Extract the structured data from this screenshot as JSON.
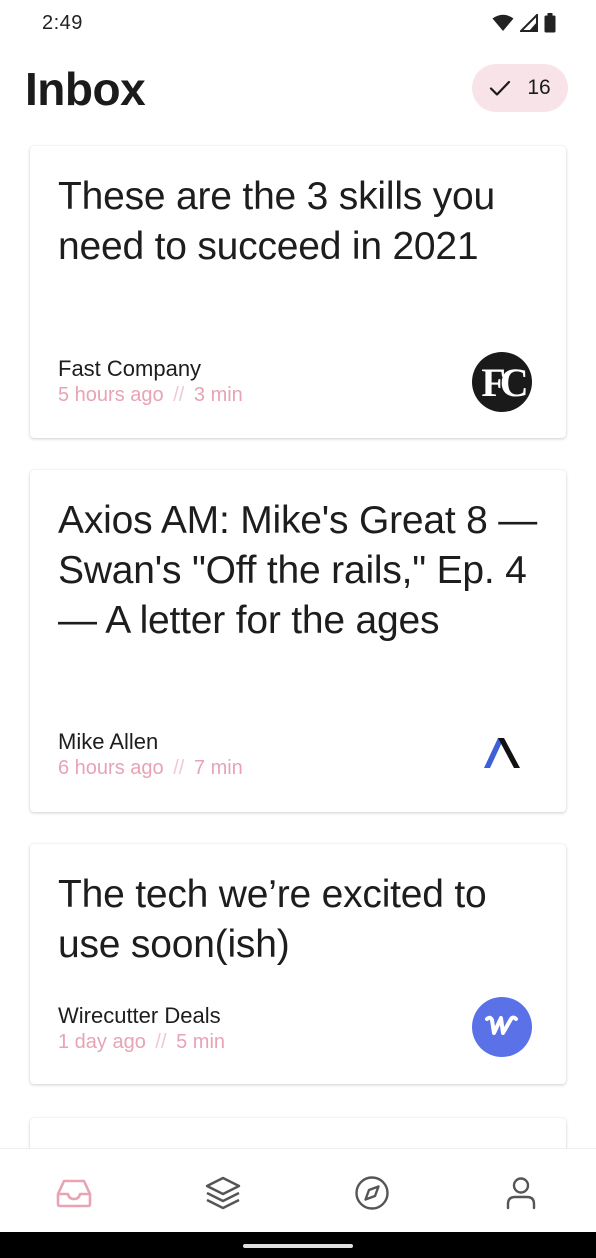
{
  "status_bar": {
    "time": "2:49",
    "icons": [
      "wifi-icon",
      "cellular-signal-icon",
      "battery-icon"
    ]
  },
  "header": {
    "title": "Inbox",
    "done_count": "16"
  },
  "articles": [
    {
      "title": "These are the 3 skills you need to succeed in 2021",
      "source": "Fast Company",
      "time_ago": "5 hours ago",
      "separator": "//",
      "read_time": "3 min",
      "logo_text": "FC"
    },
    {
      "title": "Axios AM: Mike's Great 8 — Swan's \"Off the rails,\" Ep. 4 — A letter for the ages",
      "source": "Mike Allen",
      "time_ago": "6 hours ago",
      "separator": "//",
      "read_time": "7 min",
      "logo_text": ""
    },
    {
      "title": "The tech we’re excited to use soon(ish)",
      "source": "Wirecutter Deals",
      "time_ago": "1 day ago",
      "separator": "//",
      "read_time": "5 min",
      "logo_text": ""
    }
  ],
  "bottom_nav": {
    "items": [
      "inbox-icon",
      "layers-icon",
      "compass-icon",
      "profile-icon"
    ],
    "active": "inbox-icon"
  },
  "colors": {
    "accent": "#e8a3b4",
    "pill_bg": "#f8e4e8",
    "wirecutter_blue": "#5b71e8",
    "axios_blue": "#3d5fd9"
  }
}
